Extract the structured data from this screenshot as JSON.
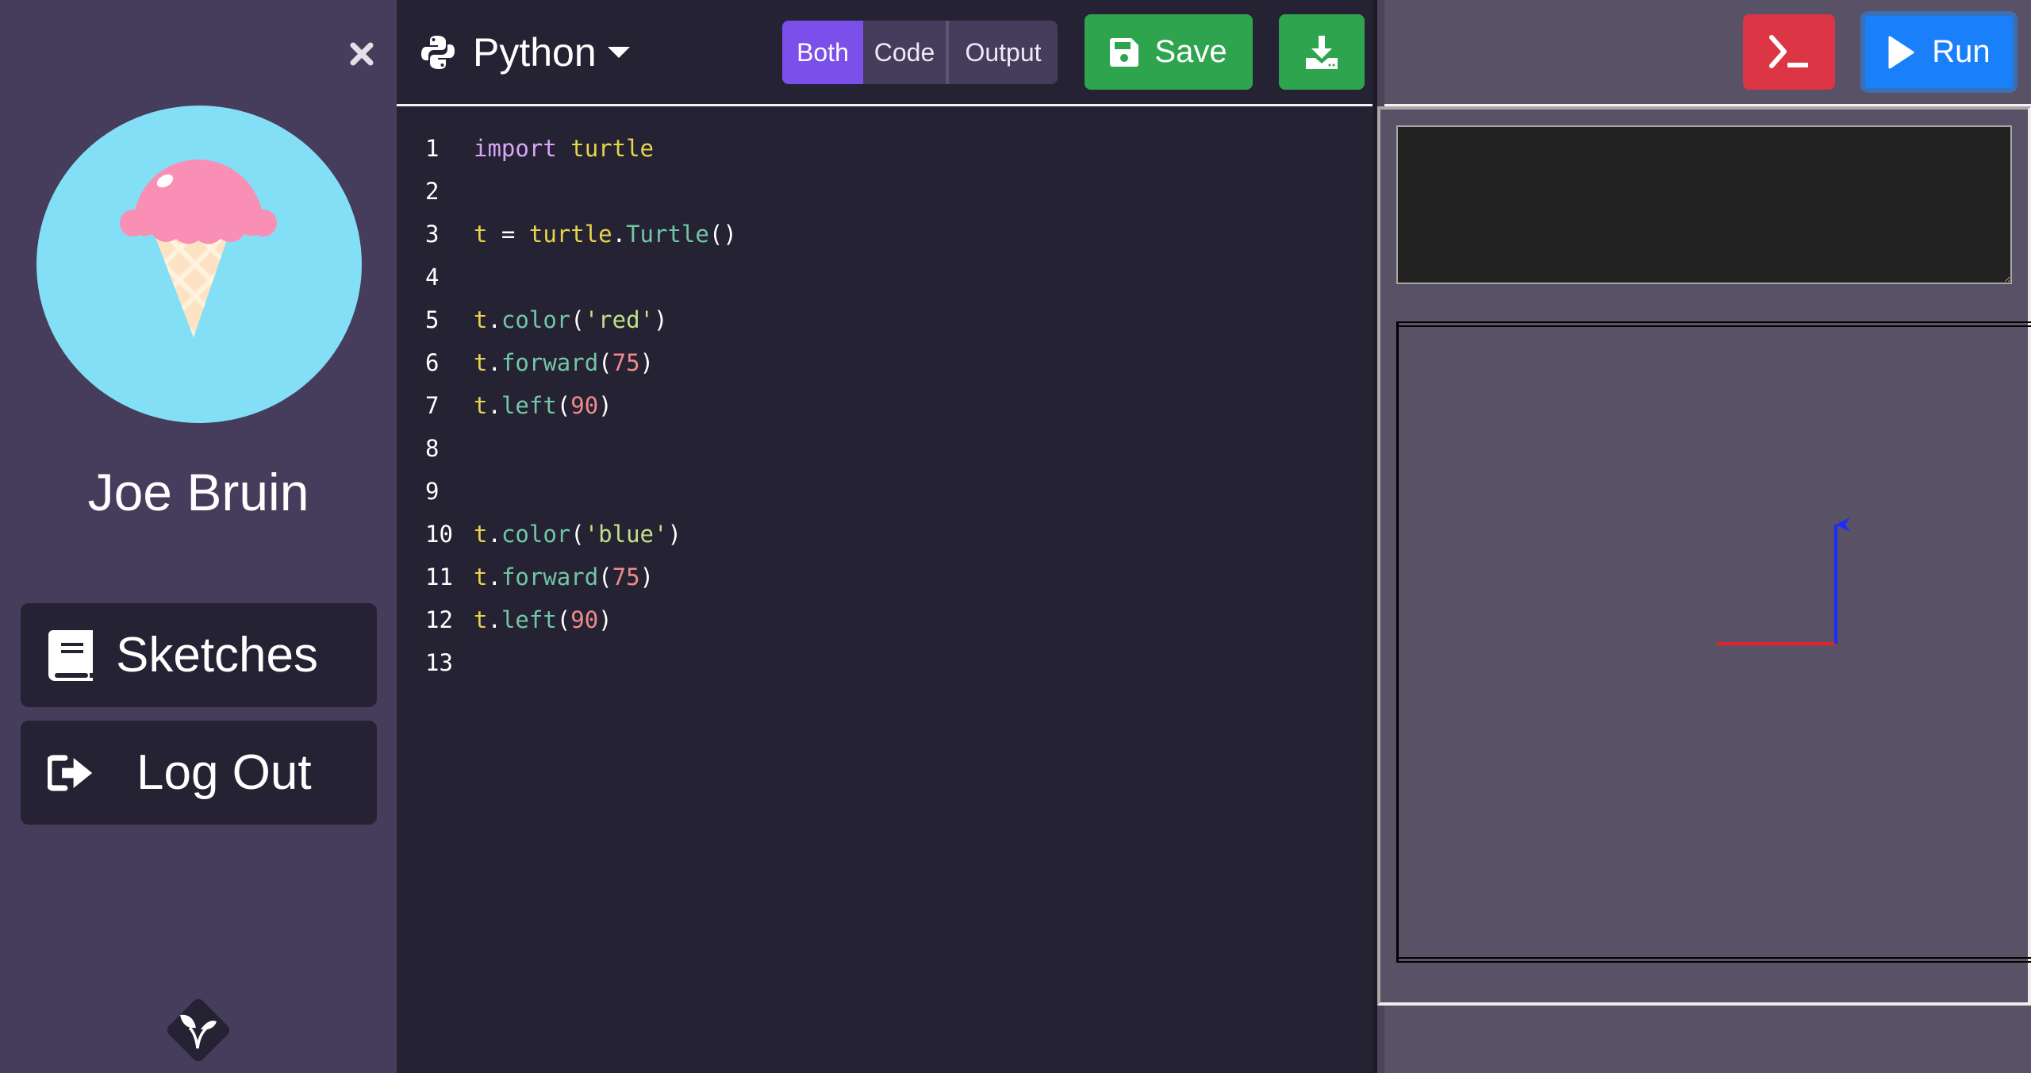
{
  "sidebar": {
    "close_icon": "close-icon",
    "user_name": "Joe Bruin",
    "avatar": "ice-cream-avatar",
    "items": [
      {
        "label": "Sketches",
        "icon": "book-icon"
      },
      {
        "label": "Log Out",
        "icon": "sign-out-icon"
      }
    ],
    "logo_icon": "sprout-icon"
  },
  "editor": {
    "language": {
      "label": "Python",
      "icon": "python-icon"
    },
    "view_modes": [
      {
        "label": "Both",
        "active": true
      },
      {
        "label": "Code",
        "active": false
      },
      {
        "label": "Output",
        "active": false
      }
    ],
    "save_label": "Save",
    "download_icon": "download-icon",
    "code_lines": [
      {
        "n": "1",
        "tokens": [
          {
            "t": "import",
            "c": "kw"
          },
          {
            "t": " ",
            "c": "p"
          },
          {
            "t": "turtle",
            "c": "var"
          }
        ]
      },
      {
        "n": "2",
        "tokens": []
      },
      {
        "n": "3",
        "tokens": [
          {
            "t": "t",
            "c": "var"
          },
          {
            "t": " = ",
            "c": "p"
          },
          {
            "t": "turtle",
            "c": "var"
          },
          {
            "t": ".",
            "c": "p"
          },
          {
            "t": "Turtle",
            "c": "fn"
          },
          {
            "t": "()",
            "c": "p"
          }
        ]
      },
      {
        "n": "4",
        "tokens": []
      },
      {
        "n": "5",
        "tokens": [
          {
            "t": "t",
            "c": "var"
          },
          {
            "t": ".",
            "c": "p"
          },
          {
            "t": "color",
            "c": "fn"
          },
          {
            "t": "(",
            "c": "p"
          },
          {
            "t": "'red'",
            "c": "str"
          },
          {
            "t": ")",
            "c": "p"
          }
        ]
      },
      {
        "n": "6",
        "tokens": [
          {
            "t": "t",
            "c": "var"
          },
          {
            "t": ".",
            "c": "p"
          },
          {
            "t": "forward",
            "c": "fn"
          },
          {
            "t": "(",
            "c": "p"
          },
          {
            "t": "75",
            "c": "num"
          },
          {
            "t": ")",
            "c": "p"
          }
        ]
      },
      {
        "n": "7",
        "tokens": [
          {
            "t": "t",
            "c": "var"
          },
          {
            "t": ".",
            "c": "p"
          },
          {
            "t": "left",
            "c": "fn"
          },
          {
            "t": "(",
            "c": "p"
          },
          {
            "t": "90",
            "c": "num"
          },
          {
            "t": ")",
            "c": "p"
          }
        ]
      },
      {
        "n": "8",
        "tokens": []
      },
      {
        "n": "9",
        "tokens": []
      },
      {
        "n": "10",
        "tokens": [
          {
            "t": "t",
            "c": "var"
          },
          {
            "t": ".",
            "c": "p"
          },
          {
            "t": "color",
            "c": "fn"
          },
          {
            "t": "(",
            "c": "p"
          },
          {
            "t": "'blue'",
            "c": "str"
          },
          {
            "t": ")",
            "c": "p"
          }
        ]
      },
      {
        "n": "11",
        "tokens": [
          {
            "t": "t",
            "c": "var"
          },
          {
            "t": ".",
            "c": "p"
          },
          {
            "t": "forward",
            "c": "fn"
          },
          {
            "t": "(",
            "c": "p"
          },
          {
            "t": "75",
            "c": "num"
          },
          {
            "t": ")",
            "c": "p"
          }
        ]
      },
      {
        "n": "12",
        "tokens": [
          {
            "t": "t",
            "c": "var"
          },
          {
            "t": ".",
            "c": "p"
          },
          {
            "t": "left",
            "c": "fn"
          },
          {
            "t": "(",
            "c": "p"
          },
          {
            "t": "90",
            "c": "num"
          },
          {
            "t": ")",
            "c": "p"
          }
        ]
      },
      {
        "n": "13",
        "tokens": []
      }
    ]
  },
  "output": {
    "terminal_icon": "terminal-icon",
    "run_label": "Run",
    "run_icon": "play-icon",
    "console_value": "",
    "turtle": {
      "segments": [
        {
          "color": "#e8202a",
          "heading": 0,
          "distance": 75
        },
        {
          "color": "#1a2dff",
          "heading": 90,
          "distance": 75
        }
      ],
      "final_heading": 180,
      "cursor_color": "#1a2dff"
    }
  },
  "colors": {
    "sidebar_bg": "#463d5c",
    "editor_bg": "#252233",
    "output_bg": "#595166",
    "active_view": "#7b4fe9",
    "save_green": "#2ea44f",
    "terminal_red": "#dc3545",
    "run_blue": "#1a80fa"
  }
}
